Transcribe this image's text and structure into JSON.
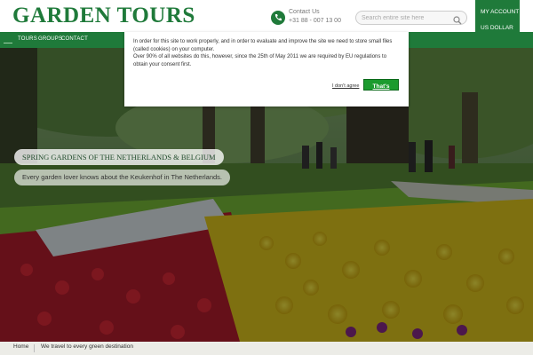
{
  "header": {
    "logo_text": "GARDEN TOURS",
    "contact_label": "Contact Us",
    "contact_number": "+31 88 - 007 13 00",
    "search_placeholder": "Search entire site here",
    "account_label": "MY ACCOUNT",
    "currency_label": "US DOLLAR",
    "brand_color": "#1f7a3a"
  },
  "nav": {
    "items": [
      "TOURS",
      "GROUPS",
      "CONTACT"
    ]
  },
  "hero": {
    "title": "SPRING GARDENS OF THE NETHERLANDS & BELGIUM",
    "subtitle": "Every garden lover knows about the Keukenhof in The Netherlands."
  },
  "cookie": {
    "line1": "In order for this site to work properly, and in order to evaluate and improve the site we need to store small files (called cookies) on your computer.",
    "line2": "Over 90% of all websites do this, however, since the 25th of May 2011 we are required by EU regulations to obtain your consent first.",
    "dont_agree": "I don't agree",
    "accept": "That's fine",
    "accept_color": "#1b9b2e"
  },
  "breadcrumb": {
    "home": "Home",
    "current": "We travel to every green destination"
  }
}
